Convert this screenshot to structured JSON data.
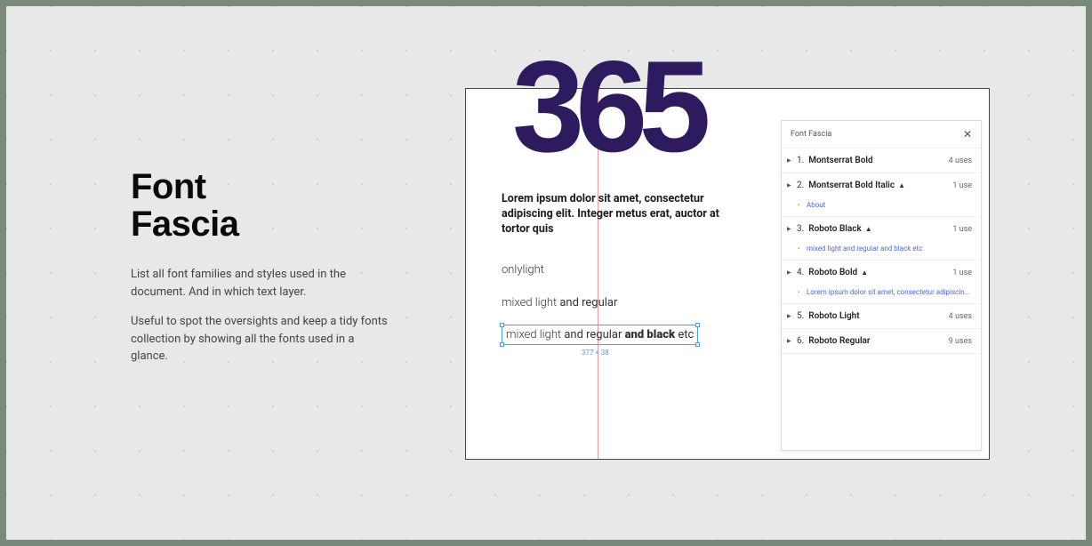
{
  "title_line1": "Font",
  "title_line2": "Fascia",
  "desc1": "List all font families and styles used in the document. And in which text layer.",
  "desc2": "Useful to spot the oversights and keep a tidy fonts collection by showing all the fonts used in a glance.",
  "canvas": {
    "big_number": "365",
    "body": "Lorem ipsum dolor sit amet, consectetur adipiscing elit. Integer metus erat, auctor at tortor quis",
    "sample1": "onlylight",
    "sample2_light": "mixed light ",
    "sample2_reg": "and regular",
    "sample3_light": "mixed light ",
    "sample3_reg": "and regular ",
    "sample3_black": "and black ",
    "sample3_tail": "etc",
    "selection_dim": "377 × 38"
  },
  "panel": {
    "title": "Font Fascia",
    "rows": [
      {
        "idx": "1.",
        "name": "Montserrat Bold",
        "uses": "4 uses",
        "warn": false
      },
      {
        "idx": "2.",
        "name": "Montserrat Bold Italic",
        "uses": "1 use",
        "warn": true
      },
      {
        "idx": "3.",
        "name": "Roboto Black",
        "uses": "1 use",
        "warn": true
      },
      {
        "idx": "4.",
        "name": "Roboto Bold",
        "uses": "1 use",
        "warn": true
      },
      {
        "idx": "5.",
        "name": "Roboto Light",
        "uses": "4 uses",
        "warn": false
      },
      {
        "idx": "6.",
        "name": "Roboto Regular",
        "uses": "9 uses",
        "warn": false
      }
    ],
    "sub_about": "About",
    "sub_mixed": "mixed light and regular and black etc",
    "sub_lorem": "Lorem ipsum dolor sit amet, consectetur adipiscing elit. Integer ..."
  }
}
